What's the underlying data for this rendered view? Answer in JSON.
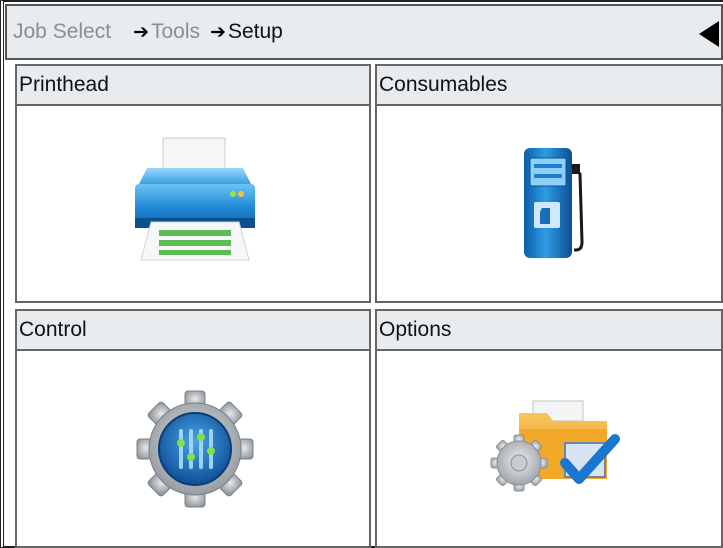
{
  "breadcrumb": {
    "items": [
      "Job Select",
      "Tools",
      "Setup"
    ],
    "separator": "➔"
  },
  "tiles": [
    {
      "label": "Printhead",
      "icon": "printer-icon"
    },
    {
      "label": "Consumables",
      "icon": "fuel-pump-icon"
    },
    {
      "label": "Control",
      "icon": "gear-sliders-icon"
    },
    {
      "label": "Options",
      "icon": "folder-gear-check-icon"
    }
  ],
  "colors": {
    "header_bg": "#e9ecef",
    "border": "#666666",
    "inactive_text": "#8a8f96",
    "accent_blue": "#1f7fd0"
  }
}
